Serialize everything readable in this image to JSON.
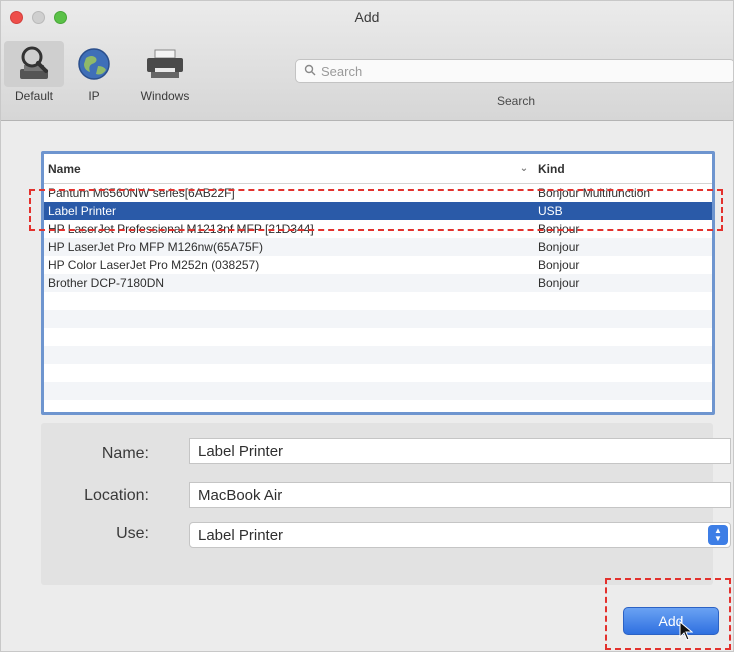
{
  "window": {
    "title": "Add"
  },
  "toolbar": {
    "tools": [
      {
        "label": "Default",
        "icon": "default-printers-icon",
        "selected": true
      },
      {
        "label": "IP",
        "icon": "globe-icon",
        "selected": false
      },
      {
        "label": "Windows",
        "icon": "windows-printer-icon",
        "selected": false
      }
    ],
    "search": {
      "placeholder": "Search",
      "label": "Search"
    }
  },
  "printer_list": {
    "columns": {
      "name": "Name",
      "kind": "Kind",
      "sort_icon": "⌄"
    },
    "rows": [
      {
        "name": "Pantum M6560NW series[6AB22F]",
        "kind": "Bonjour Multifunction",
        "selected": false
      },
      {
        "name": "Label Printer",
        "kind": "USB",
        "selected": true
      },
      {
        "name": "HP LaserJet Professional M1213nf MFP [21D344]",
        "kind": "Bonjour",
        "selected": false
      },
      {
        "name": "HP LaserJet Pro MFP M126nw(65A75F)",
        "kind": "Bonjour",
        "selected": false
      },
      {
        "name": "HP Color LaserJet Pro M252n (038257)",
        "kind": "Bonjour",
        "selected": false
      },
      {
        "name": "Brother DCP-7180DN",
        "kind": "Bonjour",
        "selected": false
      }
    ]
  },
  "form": {
    "name_label": "Name:",
    "name_value": "Label Printer",
    "location_label": "Location:",
    "location_value": "MacBook Air",
    "use_label": "Use:",
    "use_value": "Label Printer",
    "use_arrows_up": "▲",
    "use_arrows_down": "▼"
  },
  "actions": {
    "add_label": "Add"
  },
  "colors": {
    "selection": "#2a5aa8",
    "highlight": "#e3312d",
    "accent": "#3d7ee6"
  }
}
